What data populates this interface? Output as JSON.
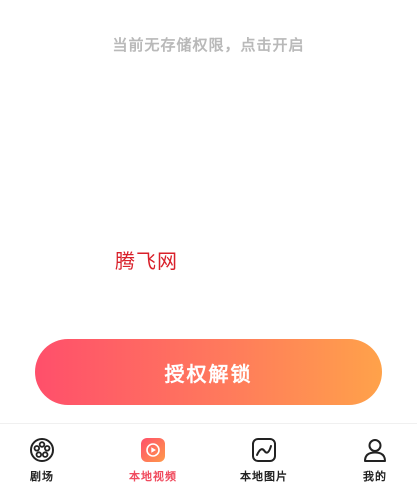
{
  "notice": "当前无存储权限，点击开启",
  "watermark": "腾飞网",
  "unlock_button": "授权解锁",
  "tabs": [
    {
      "label": "剧场",
      "icon": "film-reel-icon",
      "active": false
    },
    {
      "label": "本地视频",
      "icon": "play-video-icon",
      "active": true
    },
    {
      "label": "本地图片",
      "icon": "image-icon",
      "active": false
    },
    {
      "label": "我的",
      "icon": "person-icon",
      "active": false
    }
  ],
  "colors": {
    "accent": "#f04b5e",
    "gradient_start": "#ff4f6b",
    "gradient_end": "#ffa24a",
    "notice_text": "#b9b9b9",
    "watermark": "#d9202a"
  }
}
